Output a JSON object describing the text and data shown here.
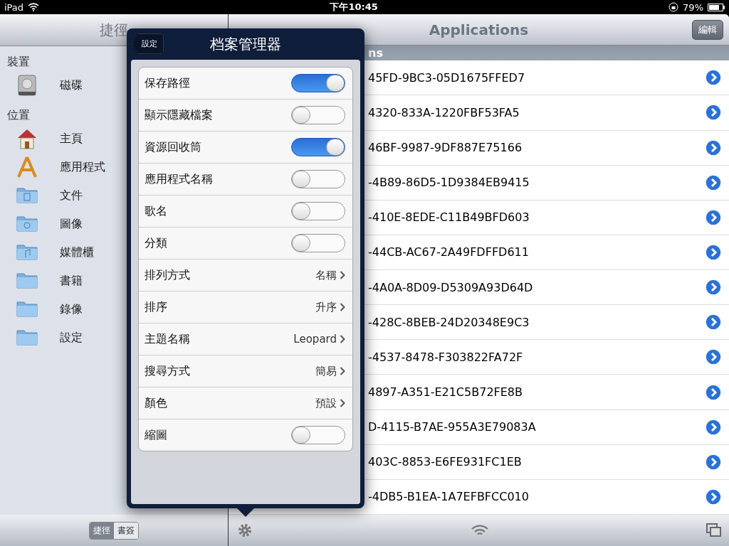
{
  "status_bar": {
    "device": "iPad",
    "time": "下午10:45",
    "battery": "79%"
  },
  "sidebar": {
    "title": "捷徑",
    "sections": [
      {
        "title": "裝置",
        "items": [
          {
            "label": "磁碟",
            "kind": "disk"
          }
        ]
      },
      {
        "title": "位置",
        "items": [
          {
            "label": "主頁",
            "kind": "home"
          },
          {
            "label": "應用程式",
            "kind": "apps"
          },
          {
            "label": "文件",
            "kind": "docs"
          },
          {
            "label": "圖像",
            "kind": "photos"
          },
          {
            "label": "媒體櫃",
            "kind": "music"
          },
          {
            "label": "書籍",
            "kind": "folder"
          },
          {
            "label": "錄像",
            "kind": "folder"
          },
          {
            "label": "設定",
            "kind": "folder"
          }
        ]
      }
    ]
  },
  "main": {
    "title": "Applications",
    "edit_button": "編輯",
    "section_header": "ns",
    "rows": [
      "45FD-9BC3-05D1675FFED7",
      "4320-833A-1220FBF53FA5",
      "46BF-9987-9DF887E75166",
      "-4B89-86D5-1D9384EB9415",
      "-410E-8EDE-C11B49BFD603",
      "-44CB-AC67-2A49FDFFD611",
      "-4A0A-8D09-D5309A93D64D",
      "-428C-8BEB-24D20348E9C3",
      "-4537-8478-F303822FA72F",
      "4897-A351-E21C5B72FE8B",
      "D-4115-B7AE-955A3E79083A",
      "403C-8853-E6FE931FC1EB",
      "-4DB5-B1EA-1A7EFBFCC010"
    ]
  },
  "popover": {
    "title": "档案管理器",
    "back_button": "設定",
    "settings": [
      {
        "kind": "toggle",
        "label": "保存路徑",
        "on": true
      },
      {
        "kind": "toggle",
        "label": "顯示隱藏檔案",
        "on": false
      },
      {
        "kind": "toggle",
        "label": "資源回收筒",
        "on": true
      },
      {
        "kind": "toggle",
        "label": "應用程式名稱",
        "on": false
      },
      {
        "kind": "toggle",
        "label": "歌名",
        "on": false
      },
      {
        "kind": "toggle",
        "label": "分類",
        "on": false
      },
      {
        "kind": "choice",
        "label": "排列方式",
        "value": "名稱"
      },
      {
        "kind": "choice",
        "label": "排序",
        "value": "升序"
      },
      {
        "kind": "choice",
        "label": "主題名稱",
        "value": "Leopard"
      },
      {
        "kind": "choice",
        "label": "搜尋方式",
        "value": "簡易"
      },
      {
        "kind": "choice",
        "label": "顏色",
        "value": "預設"
      },
      {
        "kind": "toggle",
        "label": "縮圖",
        "on": false
      }
    ]
  },
  "bottom_bar": {
    "segments": [
      {
        "label": "捷徑",
        "selected": true
      },
      {
        "label": "書簽",
        "selected": false
      }
    ]
  }
}
